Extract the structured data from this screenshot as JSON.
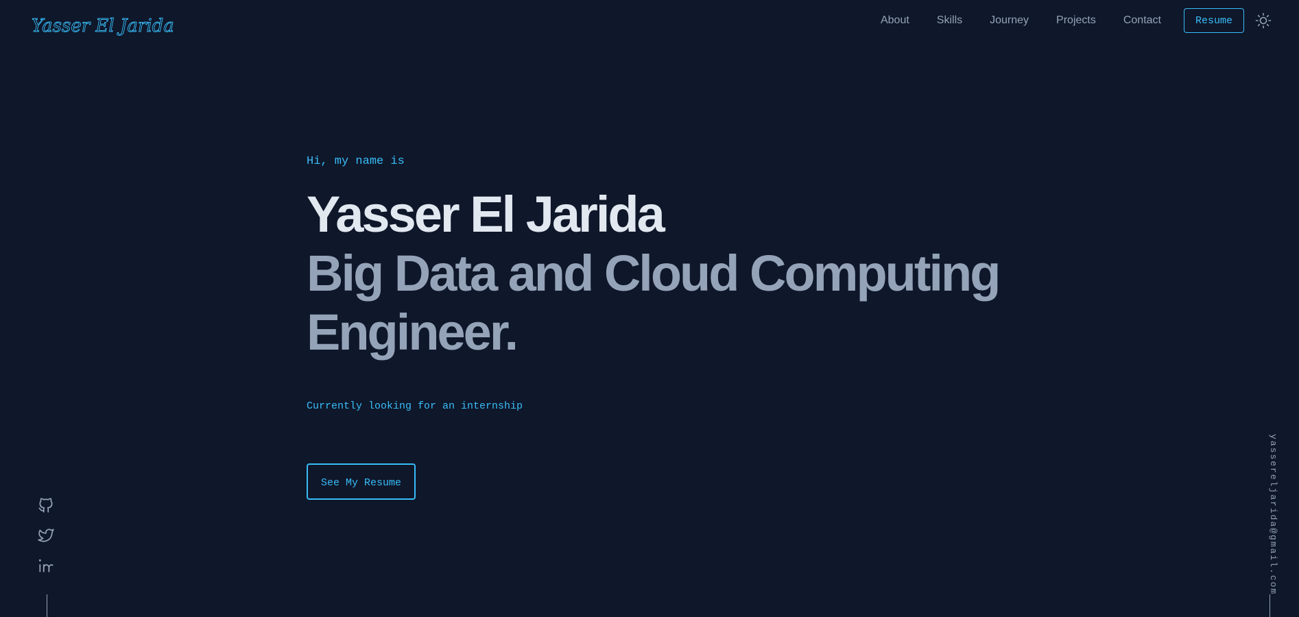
{
  "header": {
    "logo_text": "Yasser El Jarida",
    "nav": {
      "about": "About",
      "skills": "Skills",
      "journey": "Journey",
      "projects": "Projects",
      "contact": "Contact"
    },
    "resume_label": "Resume",
    "theme_icon": "sun-icon"
  },
  "hero": {
    "greeting": "Hi, my name is",
    "name": "Yasser El Jarida",
    "title": "Big Data and Cloud Computing Engineer.",
    "status": "Currently looking for an internship",
    "cta_label": "See My Resume"
  },
  "socials": {
    "icons": [
      "github-icon",
      "twitter-icon",
      "linkedin-icon"
    ]
  },
  "sidebar_right": {
    "email": "yassereljarida@gmail.com"
  },
  "colors": {
    "background": "#0f172a",
    "accent": "#38bdf8",
    "heading": "#e2e8f0",
    "muted": "#94a3b8"
  }
}
